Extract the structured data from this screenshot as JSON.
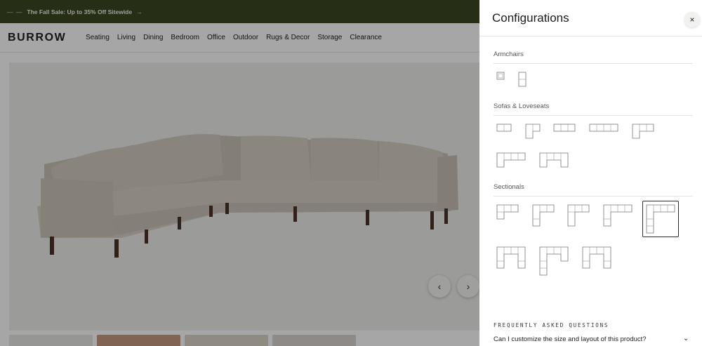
{
  "promo": {
    "text": "The Fall Sale: Up to 35% Off Sitewide",
    "arrow": "→",
    "dots": "— —"
  },
  "nav": {
    "logo": "BURROW",
    "items": [
      "Seating",
      "Living",
      "Dining",
      "Bedroom",
      "Office",
      "Outdoor",
      "Rugs & Decor",
      "Storage",
      "Clearance"
    ]
  },
  "gallery": {
    "prev_icon": "‹",
    "next_icon": "›"
  },
  "drawer": {
    "title": "Configurations",
    "close_icon": "×",
    "sections": {
      "armchairs": "Armchairs",
      "sofas": "Sofas & Loveseats",
      "sectionals": "Sectionals"
    },
    "faq_title": "FREQUENTLY ASKED QUESTIONS",
    "faq_question": "Can I customize the size and layout of this product?",
    "faq_chevron": "⌄"
  },
  "colors": {
    "promo_bg": "#3b4722",
    "selected_border": "#2b2b2b",
    "sofa": "#cfc8bd"
  }
}
